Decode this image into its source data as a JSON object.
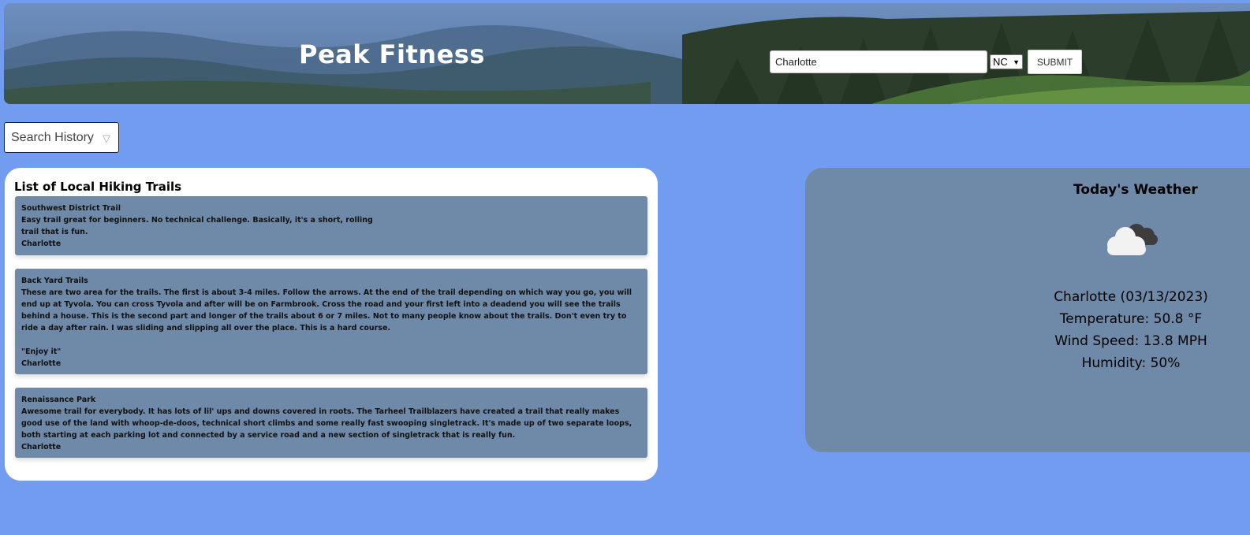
{
  "header": {
    "brand": "Peak Fitness",
    "search": {
      "city_value": "Charlotte",
      "state_value": "NC",
      "submit_label": "SUBMIT"
    }
  },
  "search_history": {
    "label": "Search History"
  },
  "trails": {
    "title": "List of Local Hiking Trails",
    "items": [
      {
        "name": "Southwest District Trail",
        "description": "Easy trail great for beginners. No technical challenge. Basically, it's a short, rolling\ntrail that is fun.",
        "city": "Charlotte"
      },
      {
        "name": "Back Yard Trails",
        "description": "These are two area for the trails. The first is about 3-4 miles. Follow the arrows. At the end of the trail depending on which way you go, you will end up at Tyvola. You can cross Tyvola and after will be on Farmbrook. Cross the road and your first left into a deadend you will see the trails behind a house. This is the second part and longer of the trails about 6 or 7 miles. Not to many people know about the trails. Don't even try to ride a day after rain. I was sliding and slipping all over the place. This is a hard course.\n\n\"Enjoy it\"",
        "city": "Charlotte"
      },
      {
        "name": "Renaissance Park",
        "description": "Awesome trail for everybody. It has lots of lil' ups and downs covered in roots. The Tarheel Trailblazers have created a trail that really makes good use of the land with whoop-de-doos, technical short climbs and some really fast swooping singletrack. It's made up of two separate loops, both starting at each parking lot and connected by a service road and a new section of singletrack that is really fun.",
        "city": "Charlotte"
      }
    ]
  },
  "weather": {
    "title": "Today's Weather",
    "icon": "cloudy-icon",
    "location": "Charlotte (03/13/2023)",
    "temperature": "Temperature: 50.8 °F",
    "wind": "Wind Speed: 13.8 MPH",
    "humidity": "Humidity: 50%"
  },
  "colors": {
    "page_bg": "#729cf0",
    "card_slate": "#6f89a8",
    "white": "#ffffff"
  }
}
